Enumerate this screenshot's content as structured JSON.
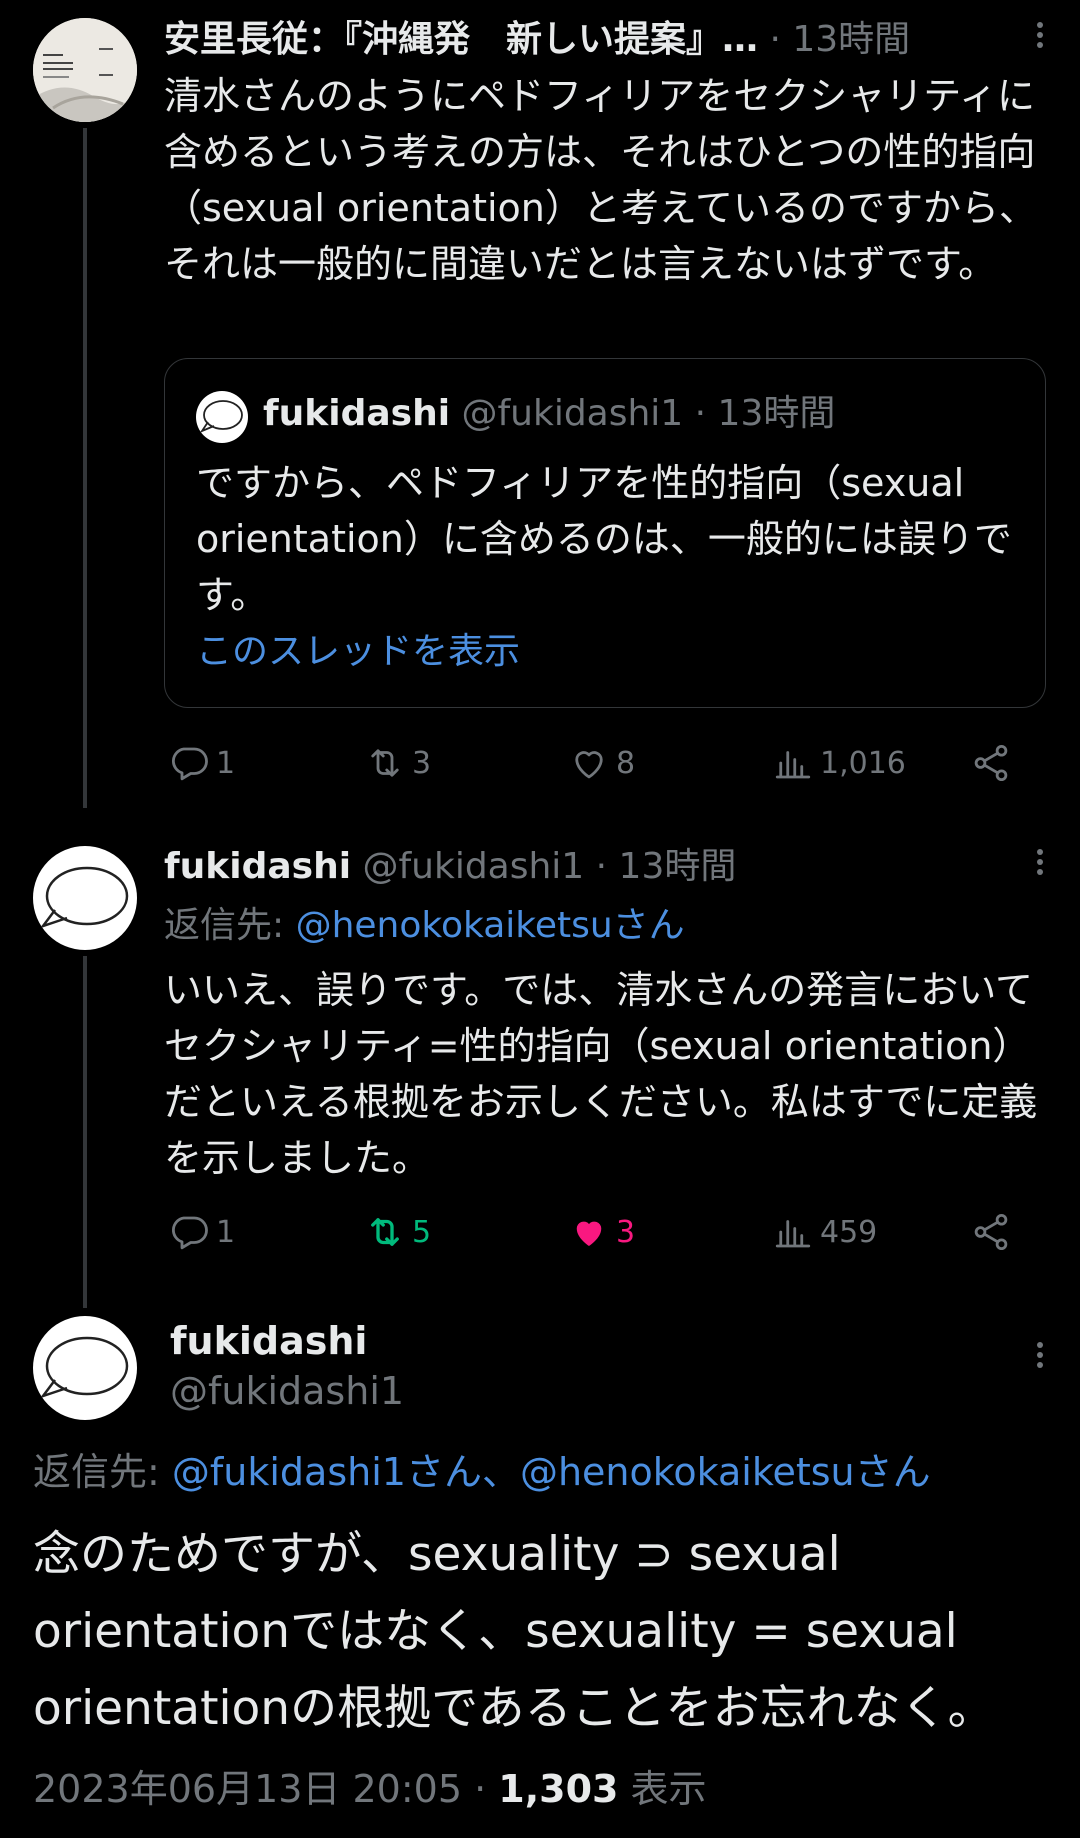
{
  "tweet1": {
    "name": "安里長従：『沖縄発　新しい提案』…",
    "time": "· 13時間",
    "text": "清水さんのようにペドフィリアをセクシャリティに含めるという考えの方は、それはひとつの性的指向（sexual orientation）と考えているのですから、それは一般的に間違いだとは言えないはずです。",
    "quote": {
      "name": "fukidashi",
      "handle": "@fukidashi1",
      "time": "· 13時間",
      "text": "ですから、ペドフィリアを性的指向（sexual orientation）に含めるのは、一般的には誤りです。",
      "show_thread": "このスレッドを表示"
    },
    "replies": "1",
    "retweets": "3",
    "likes": "8",
    "views": "1,016"
  },
  "tweet2": {
    "name": "fukidashi",
    "handle": "@fukidashi1",
    "time": "· 13時間",
    "reply_prefix": "返信先: ",
    "reply_to": "@henokokaiketsuさん",
    "text": "いいえ、誤りです。では、清水さんの発言においてセクシャリティ=性的指向（sexual orientation）だといえる根拠をお示しください。私はすでに定義を示しました。",
    "replies": "1",
    "retweets": "5",
    "likes": "3",
    "views": "459"
  },
  "focal": {
    "name": "fukidashi",
    "handle": "@fukidashi1",
    "reply_prefix": "返信先: ",
    "reply_to": "@fukidashi1さん、@henokokaiketsuさん",
    "text": "念のためですが、sexuality ⊃ sexual orientationではなく、sexuality = sexual orientationの根拠であることをお忘れなく。",
    "datetime": "2023年06月13日 20:05 · ",
    "view_count": "1,303",
    "view_label": " 表示"
  },
  "colors": {
    "background": "#000000",
    "text": "#e7e9ea",
    "muted": "#71767b",
    "link": "#4c8fe0",
    "retweet_active": "#00ba7c",
    "like_active": "#f91880"
  }
}
